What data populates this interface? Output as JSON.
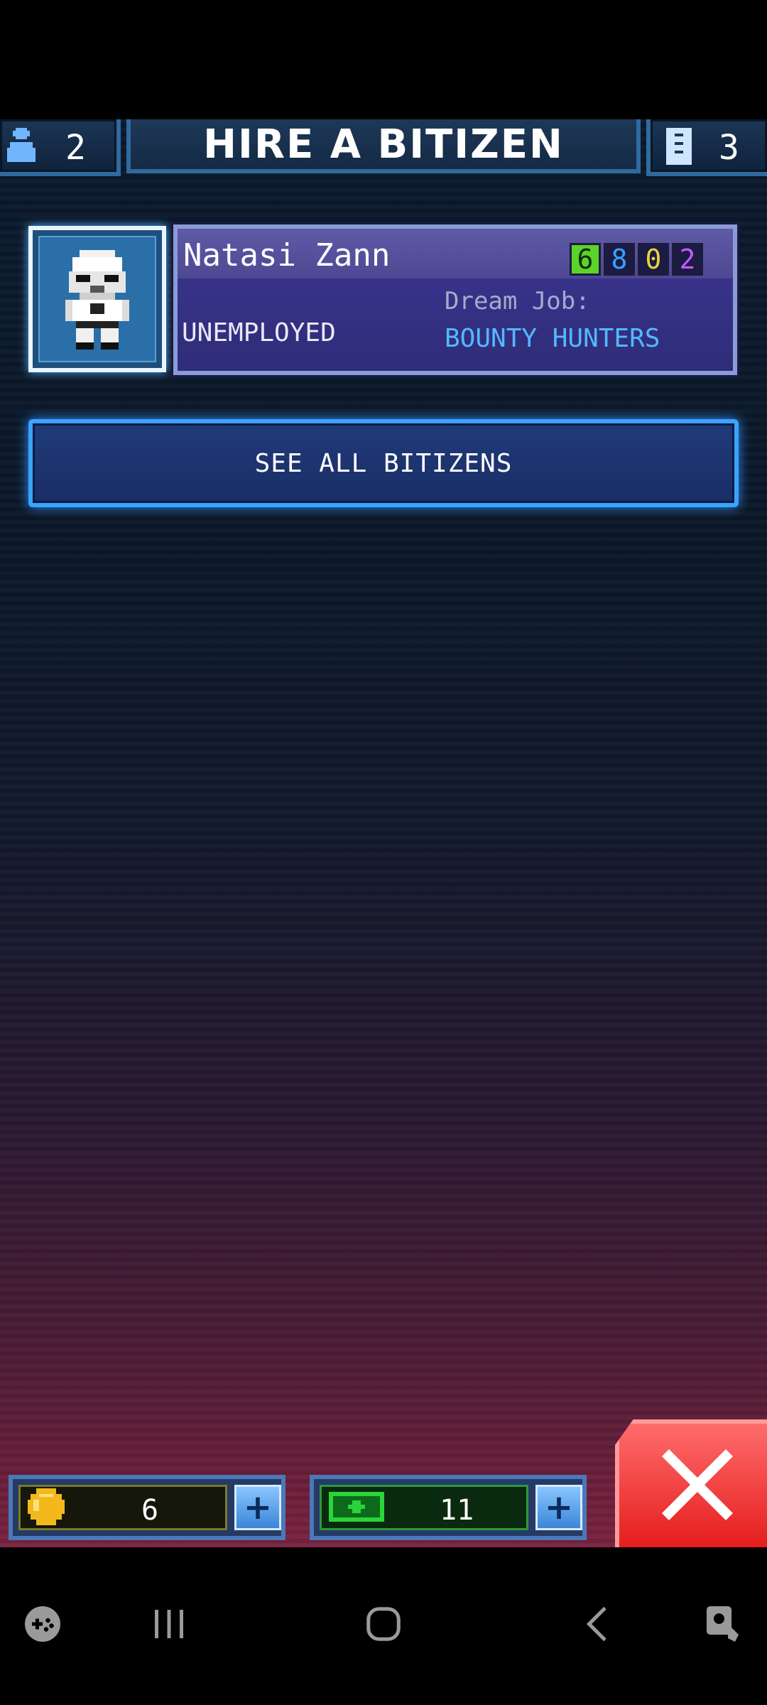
{
  "header": {
    "title": "HIRE A BITIZEN",
    "bitizen_count": "2",
    "floor_count": "3"
  },
  "bitizen": {
    "name": "Natasi Zann",
    "stats": [
      {
        "value": "6",
        "color": "#5ad42a"
      },
      {
        "value": "8",
        "color": "#3aa0ff"
      },
      {
        "value": "0",
        "color": "#e8d23a"
      },
      {
        "value": "2",
        "color": "#c45aff"
      }
    ],
    "status": "UNEMPLOYED",
    "dream_job_label": "Dream Job:",
    "dream_job": "BOUNTY HUNTERS"
  },
  "buttons": {
    "see_all": "SEE ALL BITIZENS"
  },
  "currency": {
    "coins": "6",
    "bux": "11"
  },
  "icons": {
    "bitizen": "person-icon",
    "floor": "building-icon",
    "coin": "coin-icon",
    "bux": "bux-icon",
    "plus": "plus-icon",
    "close": "close-icon"
  }
}
